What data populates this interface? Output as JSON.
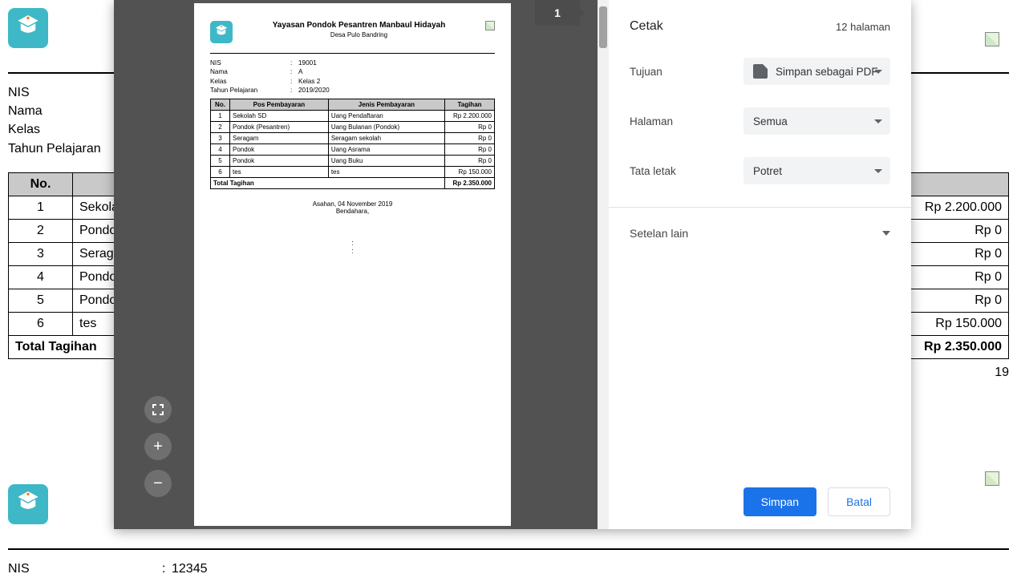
{
  "background": {
    "meta": {
      "nis_label": "NIS",
      "nama_label": "Nama",
      "kelas_label": "Kelas",
      "tahun_label": "Tahun Pelajaran",
      "nis_label2": "NIS",
      "nis_value2": "12345"
    },
    "table": {
      "headers": {
        "no": "No."
      },
      "rows": [
        {
          "no": "1",
          "pos": "Sekola",
          "amt": "Rp 2.200.000"
        },
        {
          "no": "2",
          "pos": "Pondo",
          "amt": "Rp 0"
        },
        {
          "no": "3",
          "pos": "Seraga",
          "amt": "Rp 0"
        },
        {
          "no": "4",
          "pos": "Pondo",
          "amt": "Rp 0"
        },
        {
          "no": "5",
          "pos": "Pondo",
          "amt": "Rp 0"
        },
        {
          "no": "6",
          "pos": "tes",
          "amt": "Rp 150.000"
        }
      ],
      "total_label": "Total Tagihan",
      "total_amt": "Rp 2.350.000"
    },
    "date_tail": "19"
  },
  "preview": {
    "badge": "1",
    "title": "Yayasan Pondok Pesantren Manbaul Hidayah",
    "subtitle": "Desa Pulo Bandring",
    "meta": [
      {
        "label": "NIS",
        "value": "19001"
      },
      {
        "label": "Nama",
        "value": "A"
      },
      {
        "label": "Kelas",
        "value": "Kelas 2"
      },
      {
        "label": "Tahun Pelajaran",
        "value": "2019/2020"
      }
    ],
    "headers": {
      "no": "No.",
      "pos": "Pos Pembayaran",
      "jenis": "Jenis Pembayaran",
      "tagihan": "Tagihan"
    },
    "rows": [
      {
        "no": "1",
        "pos": "Sekolah SD",
        "jenis": "Uang Pendaftaran",
        "amt": "Rp 2.200.000"
      },
      {
        "no": "2",
        "pos": "Pondok (Pesantren)",
        "jenis": "Uang Bulanan (Pondok)",
        "amt": "Rp 0"
      },
      {
        "no": "3",
        "pos": "Seragam",
        "jenis": "Seragam sekolah",
        "amt": "Rp 0"
      },
      {
        "no": "4",
        "pos": "Pondok",
        "jenis": "Uang Asrama",
        "amt": "Rp 0"
      },
      {
        "no": "5",
        "pos": "Pondok",
        "jenis": "Uang Buku",
        "amt": "Rp 0"
      },
      {
        "no": "6",
        "pos": "tes",
        "jenis": "tes",
        "amt": "Rp 150.000"
      }
    ],
    "total_label": "Total Tagihan",
    "total_amt": "Rp 2.350.000",
    "footer_line1": "Asahan, 04 November 2019",
    "footer_line2": "Bendahara,"
  },
  "panel": {
    "title": "Cetak",
    "page_count": "12 halaman",
    "fields": {
      "tujuan": "Tujuan",
      "tujuan_value": "Simpan sebagai PDF",
      "halaman": "Halaman",
      "halaman_value": "Semua",
      "tata": "Tata letak",
      "tata_value": "Potret",
      "more": "Setelan lain"
    },
    "save": "Simpan",
    "cancel": "Batal"
  }
}
